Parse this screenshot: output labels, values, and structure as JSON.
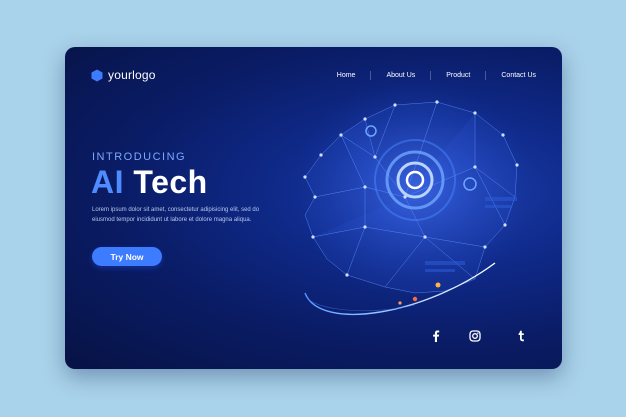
{
  "brand": {
    "logo_text": "yourlogo",
    "logo_icon": "hexagon-icon"
  },
  "nav": {
    "items": [
      {
        "label": "Home"
      },
      {
        "label": "About Us"
      },
      {
        "label": "Product"
      },
      {
        "label": "Contact Us"
      }
    ]
  },
  "hero": {
    "intro": "INTRODUCING",
    "title_accent": "AI",
    "title_rest": "Tech",
    "body": "Lorem ipsum dolor sit amet, consectetur adipisicing elit, sed do eiusmod tempor incididunt ut labore et dolore magna aliqua.",
    "cta_label": "Try Now",
    "illustration": "ai-robot-head-illustration"
  },
  "social": {
    "icons": [
      "facebook-icon",
      "instagram-icon",
      "tumblr-icon"
    ]
  },
  "colors": {
    "background": "#a9d3ea",
    "card": "#0a1c66",
    "accent": "#3d7bff",
    "intro": "#7aa8ff",
    "text": "#ffffff"
  }
}
